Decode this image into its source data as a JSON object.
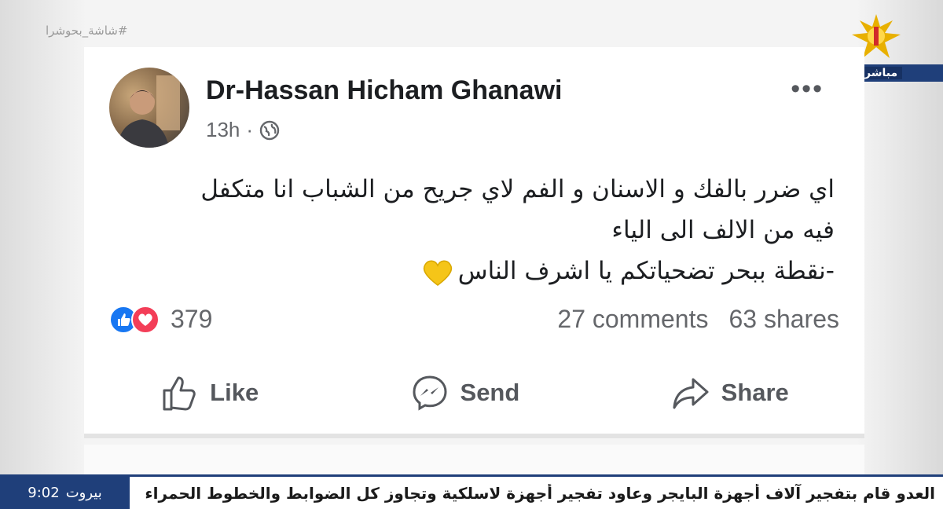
{
  "overlay": {
    "hashtag": "#شاشة_بحوشرا",
    "live_label": "مباشر"
  },
  "post": {
    "author": "Dr-Hassan Hicham Ghanawi",
    "time": "13h",
    "separator": "·",
    "more_label": "•••",
    "text_lines": [
      "اي ضرر بالفك و الاسنان و الفم لاي جريح من الشباب انا متكفل",
      "فيه من الالف الى الياء",
      "-نقطة ببحر تضحياتكم يا اشرف الناس"
    ],
    "reaction_count": "379",
    "comments": "27 comments",
    "shares": "63 shares"
  },
  "actions": {
    "like": "Like",
    "send": "Send",
    "share": "Share"
  },
  "ticker": {
    "time": "9:02",
    "city": "بيروت",
    "headline": "العدو قام بتفجير آلاف أجهزة البايجر وعاود تفجير أجهزة لاسلكية وتجاوز كل الضوابط والخطوط الحمراء"
  },
  "colors": {
    "facebook_blue": "#1877f2",
    "love_red": "#f33e58",
    "channel_navy": "#1f3f7a",
    "emoji_heart_yellow": "#f5c518"
  }
}
